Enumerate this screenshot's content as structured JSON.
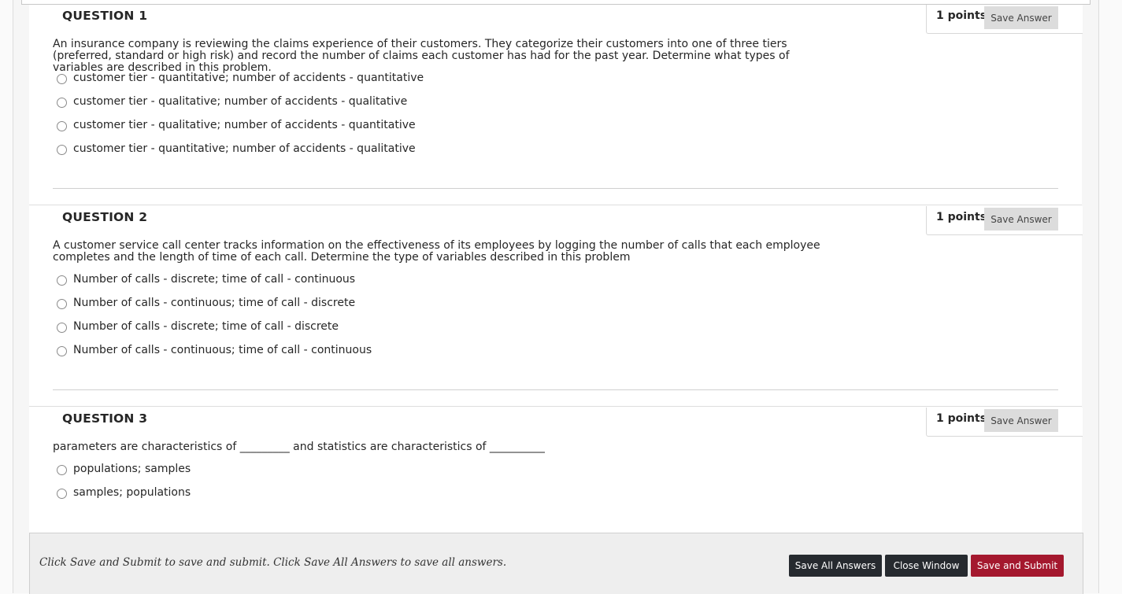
{
  "questions": [
    {
      "title": "QUESTION 1",
      "points": "1 points",
      "save_label": "Save Answer",
      "text": "An insurance company is reviewing the claims experience of their customers. They categorize their customers into one of three tiers (preferred, standard or high risk) and record the number of claims each customer has had for the past year. Determine what types of variables are described in this problem.",
      "options": [
        "customer tier - quantitative; number of accidents - quantitative",
        "customer tier - qualitative; number of accidents - qualitative",
        "customer tier - qualitative; number of accidents - quantitative",
        "customer tier - quantitative; number of accidents - qualitative"
      ]
    },
    {
      "title": "QUESTION 2",
      "points": "1 points",
      "save_label": "Save Answer",
      "text": "A customer service call center tracks information on the effectiveness of its employees by logging the number of calls that each employee completes and the length of time of each call. Determine the type of variables described in this problem",
      "options": [
        "Number of calls - discrete; time of call - continuous",
        "Number of calls - continuous; time of call - discrete",
        "Number of calls - discrete; time of call - discrete",
        "Number of calls - continuous; time of call - continuous"
      ]
    },
    {
      "title": "QUESTION 3",
      "points": "1 points",
      "save_label": "Save Answer",
      "text": "parameters are characteristics of _________ and statistics are characteristics of __________",
      "options": [
        "populations; samples",
        "samples; populations"
      ]
    }
  ],
  "footer": {
    "note": "Click Save and Submit to save and submit. Click Save All Answers to save all answers.",
    "save_all_label": "Save All Answers",
    "close_label": "Close Window",
    "submit_label": "Save and Submit"
  },
  "colors": {
    "submit_button": "#a4182e",
    "dark_button": "#262a2f",
    "save_answer_button": "#dcdcdc"
  }
}
